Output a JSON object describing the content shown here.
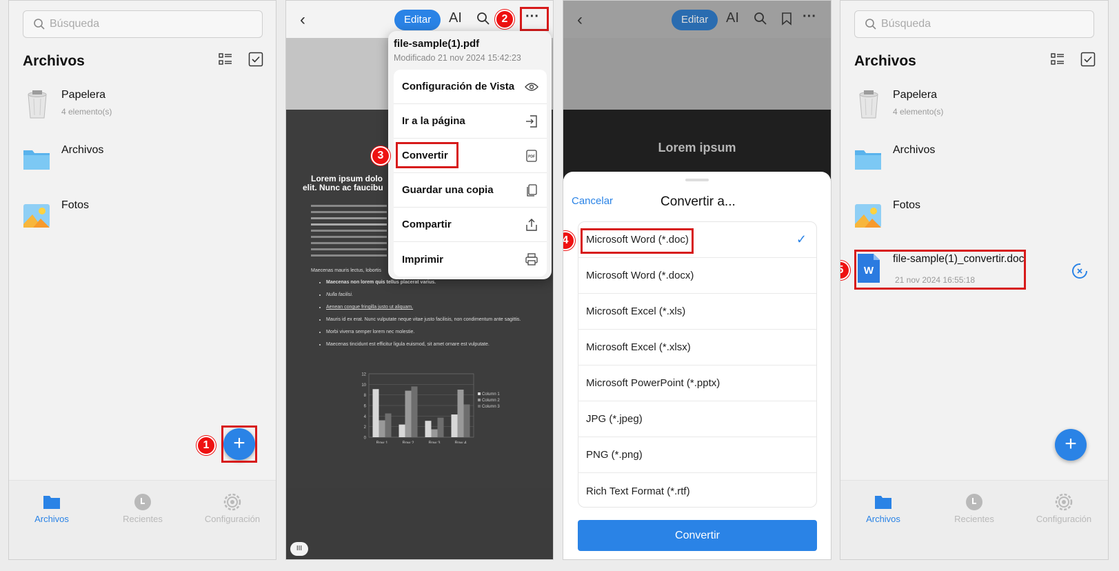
{
  "files": {
    "search_placeholder": "Búsqueda",
    "title": "Archivos",
    "items": [
      {
        "name": "Papelera",
        "sub": "4 elemento(s)",
        "icon": "trash-icon"
      },
      {
        "name": "Archivos",
        "sub": "",
        "icon": "folder-icon"
      },
      {
        "name": "Fotos",
        "sub": "",
        "icon": "photos-icon"
      }
    ],
    "new_file": {
      "name": "file-sample(1)_convertir.doc",
      "date": "21 nov 2024 16:55:18"
    },
    "nav": [
      "Archivos",
      "Recientes",
      "Configuración"
    ],
    "fab": "+"
  },
  "viewer": {
    "edit_label": "Editar",
    "ai_label": "AI",
    "more_label": "···",
    "file_name": "file-sample(1).pdf",
    "modified": "Modificado 21 nov 2024 15:42:23",
    "menu": [
      "Configuración de Vista",
      "Ir a la página",
      "Convertir",
      "Guardar una copia",
      "Compartir",
      "Imprimir"
    ],
    "doc_heading": "Lorem ipsum dolo",
    "doc_heading2": "elit. Nunc ac faucibu",
    "bullets": [
      "Maecenas non lorem quis tellus placerat varius.",
      "Nulla facilisi.",
      "Aenean congue fringilla justo ut aliquam.",
      "Mauris id ex erat. Nunc vulputate neque vitae justo facilisis, non condimentum ante sagittis.",
      "Morbi viverra semper lorem nec molestie.",
      "Maecenas tincidunt est efficitur ligula euismod, sit amet ornare est vulputate."
    ],
    "para_tail": "Maecenas mauris lectus, lobortis",
    "page_indicator": "III"
  },
  "convert": {
    "doc_title": "Lorem ipsum",
    "cancel": "Cancelar",
    "title": "Convertir a...",
    "options": [
      "Microsoft Word (*.doc)",
      "Microsoft Word (*.docx)",
      "Microsoft Excel (*.xls)",
      "Microsoft Excel (*.xlsx)",
      "Microsoft PowerPoint (*.pptx)",
      "JPG (*.jpeg)",
      "PNG (*.png)",
      "Rich Text Format (*.rtf)"
    ],
    "selected_index": 0,
    "button": "Convertir"
  },
  "steps": [
    "1",
    "2",
    "3",
    "4",
    "5"
  ],
  "chart_data": {
    "type": "bar",
    "categories": [
      "Row 1",
      "Row 2",
      "Row 3",
      "Row 4"
    ],
    "series": [
      {
        "name": "Column 1",
        "values": [
          9.1,
          2.4,
          3.1,
          4.3
        ]
      },
      {
        "name": "Column 2",
        "values": [
          3.2,
          8.8,
          1.5,
          9.0
        ]
      },
      {
        "name": "Column 3",
        "values": [
          4.5,
          9.6,
          3.7,
          6.2
        ]
      }
    ],
    "ylim": [
      0,
      12
    ],
    "yticks": [
      "0",
      "2",
      "4",
      "6",
      "8",
      "10",
      "12"
    ]
  },
  "colors": {
    "accent": "#2a83e6",
    "highlight": "#d71a1a"
  }
}
